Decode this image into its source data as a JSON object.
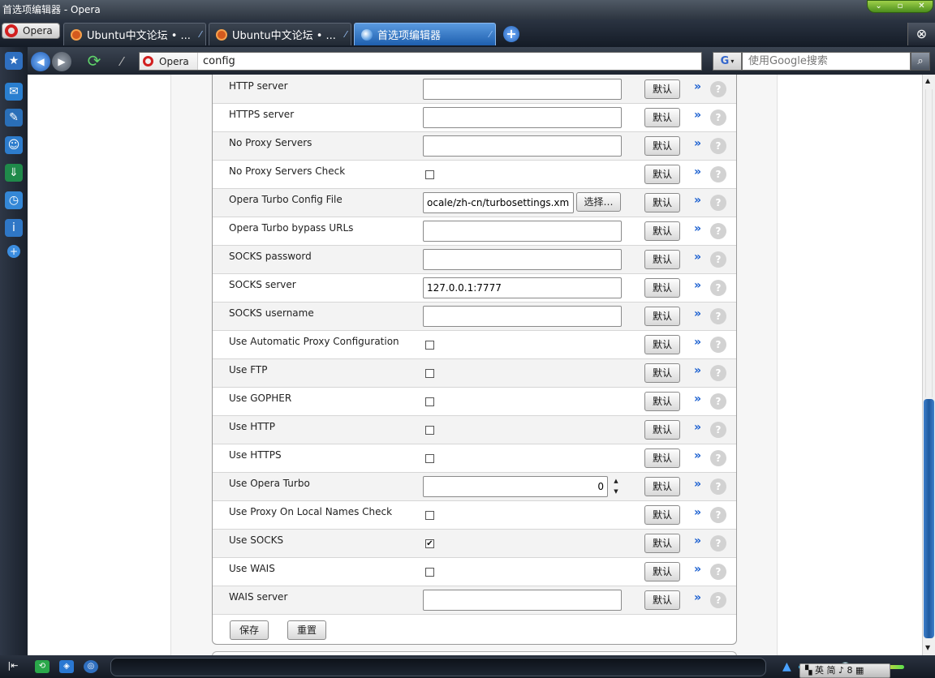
{
  "window": {
    "title": "首选项编辑器 - Opera",
    "controls": [
      "⌄",
      "▫",
      "✕"
    ]
  },
  "tabbar": {
    "menu_label": "Opera",
    "tabs": [
      {
        "label": "Ubuntu中文论坛 • ...",
        "icon": "ubuntu-icon",
        "active": false
      },
      {
        "label": "Ubuntu中文论坛 • ...",
        "icon": "ubuntu-icon",
        "active": false
      },
      {
        "label": "首选项编辑器",
        "icon": "globe-icon",
        "active": true
      }
    ],
    "new_tab_icon": "plus-icon",
    "closed_tabs_icon": "trash-icon"
  },
  "sidebar": {
    "items": [
      "bookmarks-icon",
      "mail-icon",
      "notes-icon",
      "contacts-icon",
      "downloads-icon",
      "history-icon",
      "info-icon",
      "add-panel-icon"
    ]
  },
  "addressbar": {
    "site_badge": "Opera",
    "url": "config",
    "search_placeholder": "使用Google搜索",
    "search_engine": "G"
  },
  "prefs": {
    "rows": [
      {
        "label": "HTTP server",
        "type": "text",
        "value": ""
      },
      {
        "label": "HTTPS server",
        "type": "text",
        "value": ""
      },
      {
        "label": "No Proxy Servers",
        "type": "text",
        "value": ""
      },
      {
        "label": "No Proxy Servers Check",
        "type": "checkbox",
        "checked": false
      },
      {
        "label": "Opera Turbo Config File",
        "type": "file",
        "value": "ocale/zh-cn/turbosettings.xml'"
      },
      {
        "label": "Opera Turbo bypass URLs",
        "type": "text",
        "value": ""
      },
      {
        "label": "SOCKS password",
        "type": "text",
        "value": ""
      },
      {
        "label": "SOCKS server",
        "type": "text",
        "value": "127.0.0.1:7777"
      },
      {
        "label": "SOCKS username",
        "type": "text",
        "value": ""
      },
      {
        "label": "Use Automatic Proxy Configuration",
        "type": "checkbox",
        "checked": false
      },
      {
        "label": "Use FTP",
        "type": "checkbox",
        "checked": false
      },
      {
        "label": "Use GOPHER",
        "type": "checkbox",
        "checked": false
      },
      {
        "label": "Use HTTP",
        "type": "checkbox",
        "checked": false
      },
      {
        "label": "Use HTTPS",
        "type": "checkbox",
        "checked": false
      },
      {
        "label": "Use Opera Turbo",
        "type": "number",
        "value": "0"
      },
      {
        "label": "Use Proxy On Local Names Check",
        "type": "checkbox",
        "checked": false
      },
      {
        "label": "Use SOCKS",
        "type": "checkbox",
        "checked": true
      },
      {
        "label": "Use WAIS",
        "type": "checkbox",
        "checked": false
      },
      {
        "label": "WAIS server",
        "type": "text",
        "value": ""
      }
    ],
    "default_label": "默认",
    "more_label": "»",
    "help_label": "?",
    "choose_label": "选择…",
    "check_mark": "✔",
    "save_label": "保存",
    "reset_label": "重置"
  },
  "statusbar": {
    "panel_toggle_label": "|⇤",
    "ime_text": "▚ 英 简 ♪ 8 ▦"
  }
}
